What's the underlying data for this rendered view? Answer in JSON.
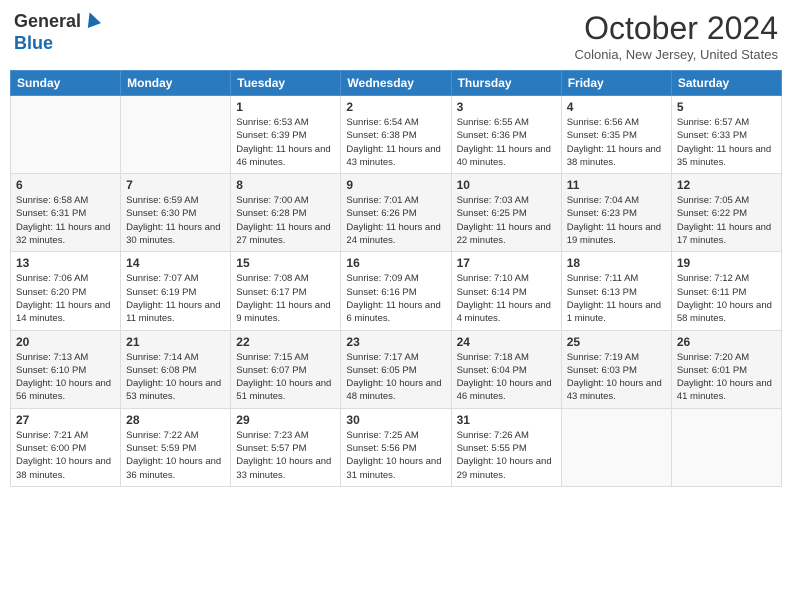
{
  "header": {
    "logo_general": "General",
    "logo_blue": "Blue",
    "month_title": "October 2024",
    "subtitle": "Colonia, New Jersey, United States"
  },
  "weekdays": [
    "Sunday",
    "Monday",
    "Tuesday",
    "Wednesday",
    "Thursday",
    "Friday",
    "Saturday"
  ],
  "weeks": [
    [
      {
        "day": "",
        "info": ""
      },
      {
        "day": "",
        "info": ""
      },
      {
        "day": "1",
        "info": "Sunrise: 6:53 AM\nSunset: 6:39 PM\nDaylight: 11 hours and 46 minutes."
      },
      {
        "day": "2",
        "info": "Sunrise: 6:54 AM\nSunset: 6:38 PM\nDaylight: 11 hours and 43 minutes."
      },
      {
        "day": "3",
        "info": "Sunrise: 6:55 AM\nSunset: 6:36 PM\nDaylight: 11 hours and 40 minutes."
      },
      {
        "day": "4",
        "info": "Sunrise: 6:56 AM\nSunset: 6:35 PM\nDaylight: 11 hours and 38 minutes."
      },
      {
        "day": "5",
        "info": "Sunrise: 6:57 AM\nSunset: 6:33 PM\nDaylight: 11 hours and 35 minutes."
      }
    ],
    [
      {
        "day": "6",
        "info": "Sunrise: 6:58 AM\nSunset: 6:31 PM\nDaylight: 11 hours and 32 minutes."
      },
      {
        "day": "7",
        "info": "Sunrise: 6:59 AM\nSunset: 6:30 PM\nDaylight: 11 hours and 30 minutes."
      },
      {
        "day": "8",
        "info": "Sunrise: 7:00 AM\nSunset: 6:28 PM\nDaylight: 11 hours and 27 minutes."
      },
      {
        "day": "9",
        "info": "Sunrise: 7:01 AM\nSunset: 6:26 PM\nDaylight: 11 hours and 24 minutes."
      },
      {
        "day": "10",
        "info": "Sunrise: 7:03 AM\nSunset: 6:25 PM\nDaylight: 11 hours and 22 minutes."
      },
      {
        "day": "11",
        "info": "Sunrise: 7:04 AM\nSunset: 6:23 PM\nDaylight: 11 hours and 19 minutes."
      },
      {
        "day": "12",
        "info": "Sunrise: 7:05 AM\nSunset: 6:22 PM\nDaylight: 11 hours and 17 minutes."
      }
    ],
    [
      {
        "day": "13",
        "info": "Sunrise: 7:06 AM\nSunset: 6:20 PM\nDaylight: 11 hours and 14 minutes."
      },
      {
        "day": "14",
        "info": "Sunrise: 7:07 AM\nSunset: 6:19 PM\nDaylight: 11 hours and 11 minutes."
      },
      {
        "day": "15",
        "info": "Sunrise: 7:08 AM\nSunset: 6:17 PM\nDaylight: 11 hours and 9 minutes."
      },
      {
        "day": "16",
        "info": "Sunrise: 7:09 AM\nSunset: 6:16 PM\nDaylight: 11 hours and 6 minutes."
      },
      {
        "day": "17",
        "info": "Sunrise: 7:10 AM\nSunset: 6:14 PM\nDaylight: 11 hours and 4 minutes."
      },
      {
        "day": "18",
        "info": "Sunrise: 7:11 AM\nSunset: 6:13 PM\nDaylight: 11 hours and 1 minute."
      },
      {
        "day": "19",
        "info": "Sunrise: 7:12 AM\nSunset: 6:11 PM\nDaylight: 10 hours and 58 minutes."
      }
    ],
    [
      {
        "day": "20",
        "info": "Sunrise: 7:13 AM\nSunset: 6:10 PM\nDaylight: 10 hours and 56 minutes."
      },
      {
        "day": "21",
        "info": "Sunrise: 7:14 AM\nSunset: 6:08 PM\nDaylight: 10 hours and 53 minutes."
      },
      {
        "day": "22",
        "info": "Sunrise: 7:15 AM\nSunset: 6:07 PM\nDaylight: 10 hours and 51 minutes."
      },
      {
        "day": "23",
        "info": "Sunrise: 7:17 AM\nSunset: 6:05 PM\nDaylight: 10 hours and 48 minutes."
      },
      {
        "day": "24",
        "info": "Sunrise: 7:18 AM\nSunset: 6:04 PM\nDaylight: 10 hours and 46 minutes."
      },
      {
        "day": "25",
        "info": "Sunrise: 7:19 AM\nSunset: 6:03 PM\nDaylight: 10 hours and 43 minutes."
      },
      {
        "day": "26",
        "info": "Sunrise: 7:20 AM\nSunset: 6:01 PM\nDaylight: 10 hours and 41 minutes."
      }
    ],
    [
      {
        "day": "27",
        "info": "Sunrise: 7:21 AM\nSunset: 6:00 PM\nDaylight: 10 hours and 38 minutes."
      },
      {
        "day": "28",
        "info": "Sunrise: 7:22 AM\nSunset: 5:59 PM\nDaylight: 10 hours and 36 minutes."
      },
      {
        "day": "29",
        "info": "Sunrise: 7:23 AM\nSunset: 5:57 PM\nDaylight: 10 hours and 33 minutes."
      },
      {
        "day": "30",
        "info": "Sunrise: 7:25 AM\nSunset: 5:56 PM\nDaylight: 10 hours and 31 minutes."
      },
      {
        "day": "31",
        "info": "Sunrise: 7:26 AM\nSunset: 5:55 PM\nDaylight: 10 hours and 29 minutes."
      },
      {
        "day": "",
        "info": ""
      },
      {
        "day": "",
        "info": ""
      }
    ]
  ]
}
